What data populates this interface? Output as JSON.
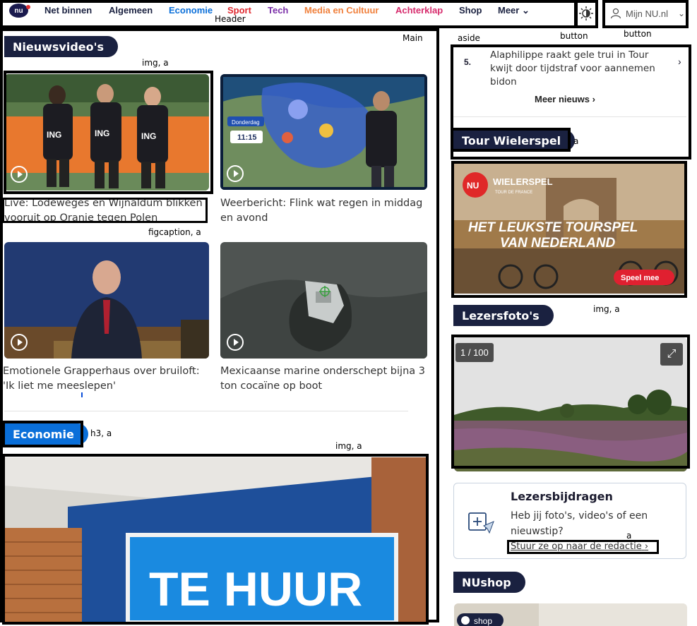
{
  "header": {
    "logo_text": "nu",
    "nav": [
      {
        "label": "Net binnen",
        "color": "#1a2140"
      },
      {
        "label": "Algemeen",
        "color": "#1a2140"
      },
      {
        "label": "Economie",
        "color": "#0a6fd9"
      },
      {
        "label": "Sport",
        "color": "#e0282e"
      },
      {
        "label": "Tech",
        "color": "#7a2fa8"
      },
      {
        "label": "Media en Cultuur",
        "color": "#f0803c"
      },
      {
        "label": "Achterklap",
        "color": "#d62b6c"
      },
      {
        "label": "Shop",
        "color": "#1a2140"
      },
      {
        "label": "Meer",
        "color": "#1a2140"
      }
    ],
    "account_label": "Mijn NU.nl"
  },
  "annotations": {
    "header": "Header",
    "main": "Main",
    "aside": "aside",
    "button1": "button",
    "button2": "button",
    "img_a_1": "img, a",
    "figcaption_a": "figcaption, a",
    "h3_a": "h3, a",
    "img_a_2": "img, a",
    "a_tour": "a",
    "img_a_3": "img, a",
    "a_stuur": "a"
  },
  "main": {
    "videos_title": "Nieuwsvideo's",
    "videos": [
      {
        "caption": "Live: Lodeweges en Wijnaldum blikken vooruit op Oranje tegen Polen"
      },
      {
        "caption": "Weerbericht: Flink wat regen in middag en avond",
        "map_day": "Donderdag",
        "map_time": "11:15"
      },
      {
        "caption": "Emotionele Grapperhaus over bruiloft: 'Ik liet me meeslepen'"
      },
      {
        "caption": "Mexicaanse marine onderschept bijna 3 ton cocaïne op boot"
      }
    ],
    "economie_title": "Economie",
    "economie_sign": "TE HUUR"
  },
  "aside": {
    "top_item": {
      "number": "5.",
      "text": "Alaphilippe raakt gele trui in Tour kwijt door tijdstraf voor aannemen bidon"
    },
    "meer_nieuws": "Meer nieuws",
    "tour_title": "Tour Wielerspel",
    "banner": {
      "brand": "WIELERSPEL",
      "sub": "TOUR DE FRANCE",
      "headline1": "HET LEUKSTE TOURSPEL",
      "headline2": "VAN NEDERLAND",
      "cta": "Speel mee"
    },
    "lezers_title": "Lezersfoto's",
    "photo_counter": "1 / 100",
    "bijdragen": {
      "title": "Lezersbijdragen",
      "text": "Heb jij foto's, video's of een nieuwstip?",
      "link": "Stuur ze op naar de redactie"
    },
    "shop_title": "NUshop",
    "shop_badge": "shop"
  }
}
